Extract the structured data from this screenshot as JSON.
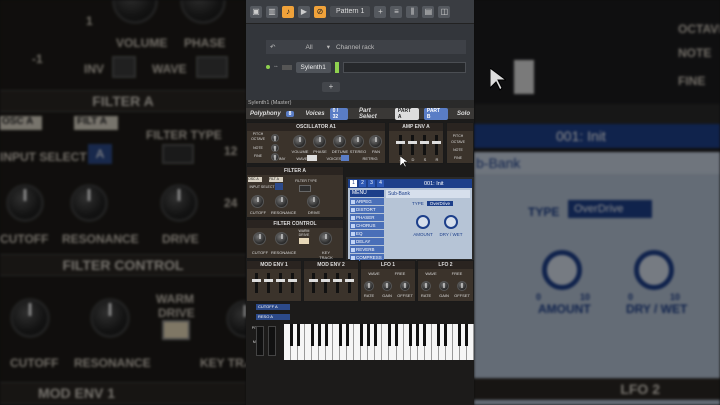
{
  "left_bg": {
    "labels": {
      "volume": "VOLUME",
      "phase": "PHASE",
      "inv": "INV",
      "wave": "WAVE",
      "minus1": "-1",
      "plus1": "1",
      "filter_a": "FILTER A",
      "osc_a": "OSC A",
      "filt_a": "FILT A",
      "input_select": "INPUT SELECT",
      "input_value": "A",
      "filter_type": "FILTER TYPE",
      "cutoff": "CUTOFF",
      "resonance": "RESONANCE",
      "drive": "DRIVE",
      "n12": "12",
      "n24": "24",
      "filter_control": "FILTER CONTROL",
      "warm": "WARM",
      "drive2": "DRIVE",
      "cutoff2": "CUTOFF",
      "resonance2": "RESONANCE",
      "key_track": "KEY TRA",
      "mod_env_1": "MOD ENV 1"
    }
  },
  "right_bg": {
    "labels": {
      "octave": "OCTAVE",
      "note": "NOTE",
      "fine": "FINE",
      "preset": "001: Init",
      "sub_bank": "b-Bank",
      "type": "TYPE",
      "type_value": "OverDrive",
      "amount": "AMOUNT",
      "dry_wet": "DRY / WET",
      "lfo2": "LFO 2",
      "n0a": "0",
      "n10a": "10",
      "n0b": "0",
      "n10b": "10"
    }
  },
  "topbar": {
    "pattern": "Pattern 1",
    "add": "+"
  },
  "channel_rack": {
    "group": "All",
    "title": "Channel rack",
    "channel": "Sylenth1",
    "add": "+"
  },
  "sylenth": {
    "window_title": "Sylenth1 (Master)",
    "polyphony_label": "Polyphony",
    "polyphony_value": "8",
    "voices_label": "Voices",
    "voices_value": "0 / 32",
    "part_select_label": "Part Select",
    "part_a": "PART A",
    "part_b": "PART B",
    "solo": "Solo",
    "osc_title": "OSCILLATOR A1",
    "osc_labels": [
      "VOLUME",
      "PHASE",
      "DETUNE",
      "STEREO",
      "PAN"
    ],
    "osc_small": [
      "INV",
      "WAVE",
      "VOICES",
      "RETRIG"
    ],
    "osc_left": [
      "PITCH",
      "OCTAVE",
      "NOTE",
      "FINE"
    ],
    "amp_title": "AMP ENV A",
    "amp_faders": [
      "A",
      "D",
      "S",
      "R"
    ],
    "filter_title": "FILTER A",
    "filter_tabs": [
      "OSC A",
      "FILT A"
    ],
    "filter_input": "INPUT SELECT",
    "filter_type": "FILTER TYPE",
    "filter_knobs": [
      "CUTOFF",
      "RESONANCE",
      "DRIVE"
    ],
    "filter_control_title": "FILTER CONTROL",
    "filter_control_knobs": [
      "CUTOFF",
      "RESONANCE",
      "KEY TRACK"
    ],
    "warm_drive": "WARM DRIVE",
    "lcd": {
      "tabs": [
        "1",
        "2",
        "3",
        "4"
      ],
      "preset": "001: Init",
      "menu_title": "MENU",
      "sub_bank": "Sub-Bank",
      "menu_items": [
        "ARPEG",
        "DISTORT",
        "PHASER",
        "CHORUS",
        "EQ",
        "DELAY",
        "REVERB",
        "COMPRESS"
      ],
      "type_label": "TYPE",
      "type_value": "OverDrive",
      "amount": "AMOUNT",
      "dry_wet": "DRY / WET"
    },
    "mod1_title": "MOD ENV 1",
    "mod2_title": "MOD ENV 2",
    "lfo1_title": "LFO 1",
    "lfo2_title": "LFO 2",
    "lfo_small": [
      "WAVE",
      "FREE"
    ],
    "lfo_knobs": [
      "RATE",
      "GAIN",
      "OFFSET"
    ],
    "mod_dest": [
      "CUTOFF A",
      "RESO A"
    ],
    "bottom_small": [
      "PITCH",
      "MOD"
    ]
  }
}
